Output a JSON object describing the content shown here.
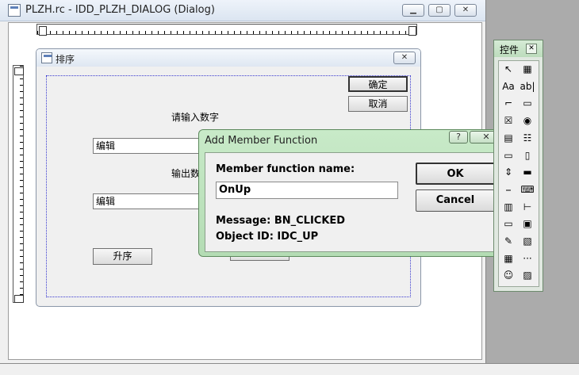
{
  "editor": {
    "title": "PLZH.rc - IDD_PLZH_DIALOG (Dialog)"
  },
  "dialog": {
    "title": "排序",
    "ok_label": "确定",
    "cancel_label": "取消",
    "prompt_label": "请输入数字",
    "input_edit": "编辑",
    "output_label": "输出数",
    "output_edit": "编辑",
    "sort_button": "升序"
  },
  "amf": {
    "title": "Add Member Function",
    "help_label": "?",
    "close_label": "✕",
    "name_label": "Member function name:",
    "name_value": "OnUp",
    "ok_label": "OK",
    "cancel_label": "Cancel",
    "message_line": "Message: BN_CLICKED",
    "object_line": "Object ID: IDC_UP"
  },
  "toolbox": {
    "title": "控件",
    "close_label": "✕",
    "tools": [
      {
        "name": "pointer-tool-icon",
        "glyph": "↖"
      },
      {
        "name": "picture-tool-icon",
        "glyph": "▦"
      },
      {
        "name": "static-text-tool-icon",
        "glyph": "Aa"
      },
      {
        "name": "edit-box-tool-icon",
        "glyph": "ab|"
      },
      {
        "name": "group-box-tool-icon",
        "glyph": "⌐"
      },
      {
        "name": "button-tool-icon",
        "glyph": "▭"
      },
      {
        "name": "check-box-tool-icon",
        "glyph": "☒"
      },
      {
        "name": "radio-button-tool-icon",
        "glyph": "◉"
      },
      {
        "name": "combo-box-tool-icon",
        "glyph": "▤"
      },
      {
        "name": "list-box-tool-icon",
        "glyph": "☷"
      },
      {
        "name": "h-scrollbar-tool-icon",
        "glyph": "▭"
      },
      {
        "name": "v-scrollbar-tool-icon",
        "glyph": "▯"
      },
      {
        "name": "spin-tool-icon",
        "glyph": "⇕"
      },
      {
        "name": "progress-tool-icon",
        "glyph": "▬"
      },
      {
        "name": "slider-tool-icon",
        "glyph": "⎯"
      },
      {
        "name": "hotkey-tool-icon",
        "glyph": "⌨"
      },
      {
        "name": "list-control-tool-icon",
        "glyph": "▥"
      },
      {
        "name": "tree-control-tool-icon",
        "glyph": "⊢"
      },
      {
        "name": "tab-control-tool-icon",
        "glyph": "▭"
      },
      {
        "name": "animate-tool-icon",
        "glyph": "▣"
      },
      {
        "name": "rich-edit-tool-icon",
        "glyph": "✎"
      },
      {
        "name": "date-time-tool-icon",
        "glyph": "▧"
      },
      {
        "name": "month-calendar-tool-icon",
        "glyph": "▦"
      },
      {
        "name": "ip-address-tool-icon",
        "glyph": "···"
      },
      {
        "name": "custom-control-tool-icon",
        "glyph": "☺"
      },
      {
        "name": "extended-combo-tool-icon",
        "glyph": "▨"
      }
    ]
  }
}
